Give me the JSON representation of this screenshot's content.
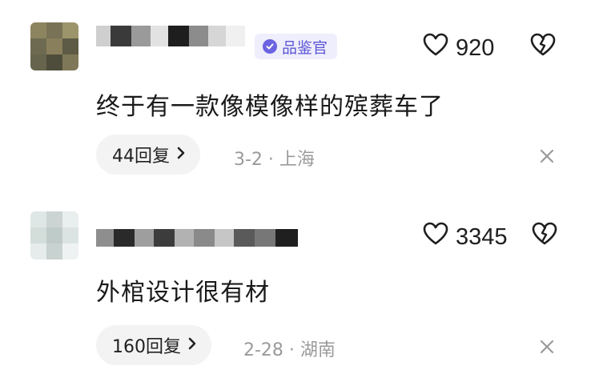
{
  "comments": [
    {
      "badge": "品鉴官",
      "likes": "920",
      "text": "终于有一款像模像样的殡葬车了",
      "reply_label": "44回复",
      "meta": "3-2 · 上海"
    },
    {
      "likes": "3345",
      "text": "外棺设计很有材",
      "reply_label": "160回复",
      "meta": "2-28 · 湖南"
    }
  ],
  "icons": {
    "like": "heart-outline-icon",
    "dislike": "broken-heart-icon",
    "close": "close-icon",
    "reply_arrow": "chevron-right-icon",
    "badge": "verified-badge-icon"
  },
  "colors": {
    "badge_text": "#5e58d6",
    "badge_bg": "#efeefc",
    "meta_text": "#9a9a9a",
    "reply_bg": "#f3f3f3"
  }
}
